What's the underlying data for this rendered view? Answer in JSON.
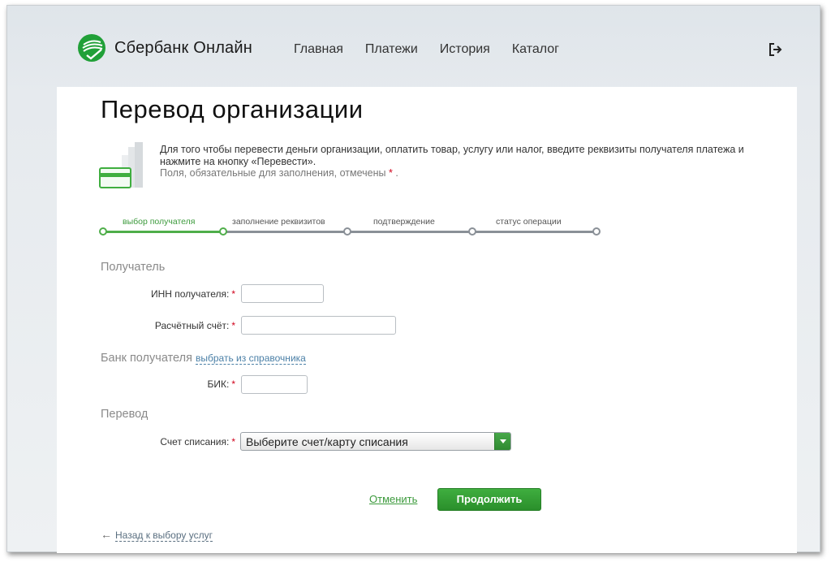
{
  "brand": {
    "name": "Сбербанк Онлайн",
    "color": "#21a038"
  },
  "nav": [
    {
      "label": "Главная"
    },
    {
      "label": "Платежи"
    },
    {
      "label": "История"
    },
    {
      "label": "Каталог"
    }
  ],
  "logout_icon": "logout-icon",
  "page": {
    "title": "Перевод организации",
    "info_text": "Для того чтобы перевести деньги организации, оплатить товар, услугу или налог, введите реквизиты получателя платежа и нажмите на кнопку «Перевести».",
    "info_note": "Поля, обязательные для заполнения, отмечены",
    "required_mark": "*"
  },
  "steps": [
    {
      "label": "выбор получателя",
      "active": true
    },
    {
      "label": "заполнение реквизитов",
      "active": false
    },
    {
      "label": "подтверждение",
      "active": false
    },
    {
      "label": "статус операции",
      "active": false
    }
  ],
  "sections": {
    "recipient": {
      "title": "Получатель",
      "inn_label": "ИНН получателя:",
      "inn_value": "",
      "account_label": "Расчётный счёт:",
      "account_value": ""
    },
    "bank": {
      "title": "Банк получателя",
      "directory_link": "выбрать из справочника",
      "bik_label": "БИК:",
      "bik_value": ""
    },
    "transfer": {
      "title": "Перевод",
      "debit_label": "Счет списания:",
      "debit_selected": "Выберите счет/карту списания"
    }
  },
  "actions": {
    "cancel": "Отменить",
    "continue": "Продолжить",
    "back": "Назад к выбору услуг"
  }
}
